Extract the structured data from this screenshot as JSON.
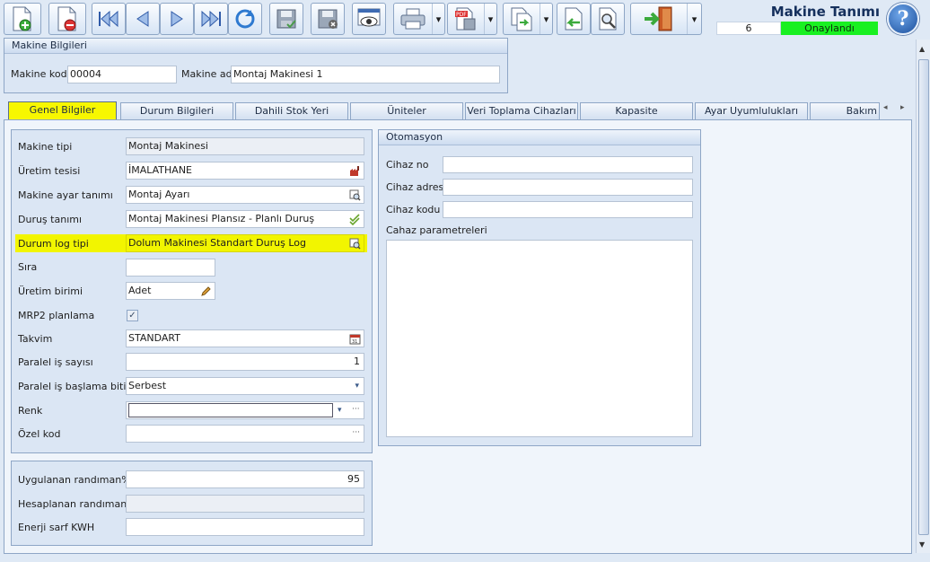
{
  "window": {
    "title": "Makine Tanımı",
    "status_number": "6",
    "status_text": "Onaylandı",
    "help_label": "?"
  },
  "toolbar": {
    "icons": [
      "new-doc-icon",
      "delete-doc-icon",
      "first-record-icon",
      "prev-record-icon",
      "next-record-icon",
      "last-record-icon",
      "refresh-icon",
      "save-approve-icon",
      "save-cancel-icon",
      "preview-icon",
      "print-icon",
      "pdf-export-icon",
      "copy-icon",
      "import-icon",
      "search-doc-icon",
      "exit-icon"
    ]
  },
  "machine_info": {
    "header": "Makine Bilgileri",
    "code_label": "Makine kodu",
    "code_value": "00004",
    "name_label": "Makine adı",
    "name_value": "Montaj Makinesi 1"
  },
  "tabs": [
    "Genel Bilgiler",
    "Durum Bilgileri",
    "Dahili Stok Yeri",
    "Üniteler",
    "Veri Toplama Cihazları",
    "Kapasite",
    "Ayar Uyumlulukları",
    "Bakım"
  ],
  "general": {
    "machine_type_label": "Makine tipi",
    "machine_type_value": "Montaj Makinesi",
    "facility_label": "Üretim tesisi",
    "facility_value": "İMALATHANE",
    "setup_label": "Makine ayar tanımı",
    "setup_value": "Montaj Ayarı",
    "stop_label": "Duruş tanımı",
    "stop_value": "Montaj Makinesi Plansız - Planlı Duruş",
    "log_label": "Durum log tipi",
    "log_value": "Dolum Makinesi Standart Duruş Log",
    "order_label": "Sıra",
    "order_value": "",
    "unit_label": "Üretim birimi",
    "unit_value": "Adet",
    "mrp_label": "MRP2 planlama",
    "mrp_check": "✓",
    "calendar_label": "Takvim",
    "calendar_value": "STANDART",
    "parallel_count_label": "Paralel iş sayısı",
    "parallel_count_value": "1",
    "parallel_start_label": "Paralel iş başlama bitiş",
    "parallel_start_value": "Serbest",
    "color_label": "Renk",
    "color_value": "",
    "special_label": "Özel kod",
    "special_value": "",
    "ellipsis": "···"
  },
  "efficiency": {
    "applied_label": "Uygulanan randıman%",
    "applied_value": "95",
    "calc_label": "Hesaplanan randıman%",
    "calc_value": "",
    "energy_label": "Enerji sarf KWH",
    "energy_value": ""
  },
  "automation": {
    "header": "Otomasyon",
    "device_no_label": "Cihaz no",
    "device_no_value": "",
    "device_addr_label": "Cihaz adresi",
    "device_addr_value": "",
    "device_code_label": "Cihaz kodu",
    "device_code_value": "",
    "params_label": "Cahaz parametreleri",
    "params_value": ""
  },
  "colors": {
    "active_tab": "#f7f700",
    "status_ok": "#19f021",
    "highlight": "#f2f500"
  }
}
